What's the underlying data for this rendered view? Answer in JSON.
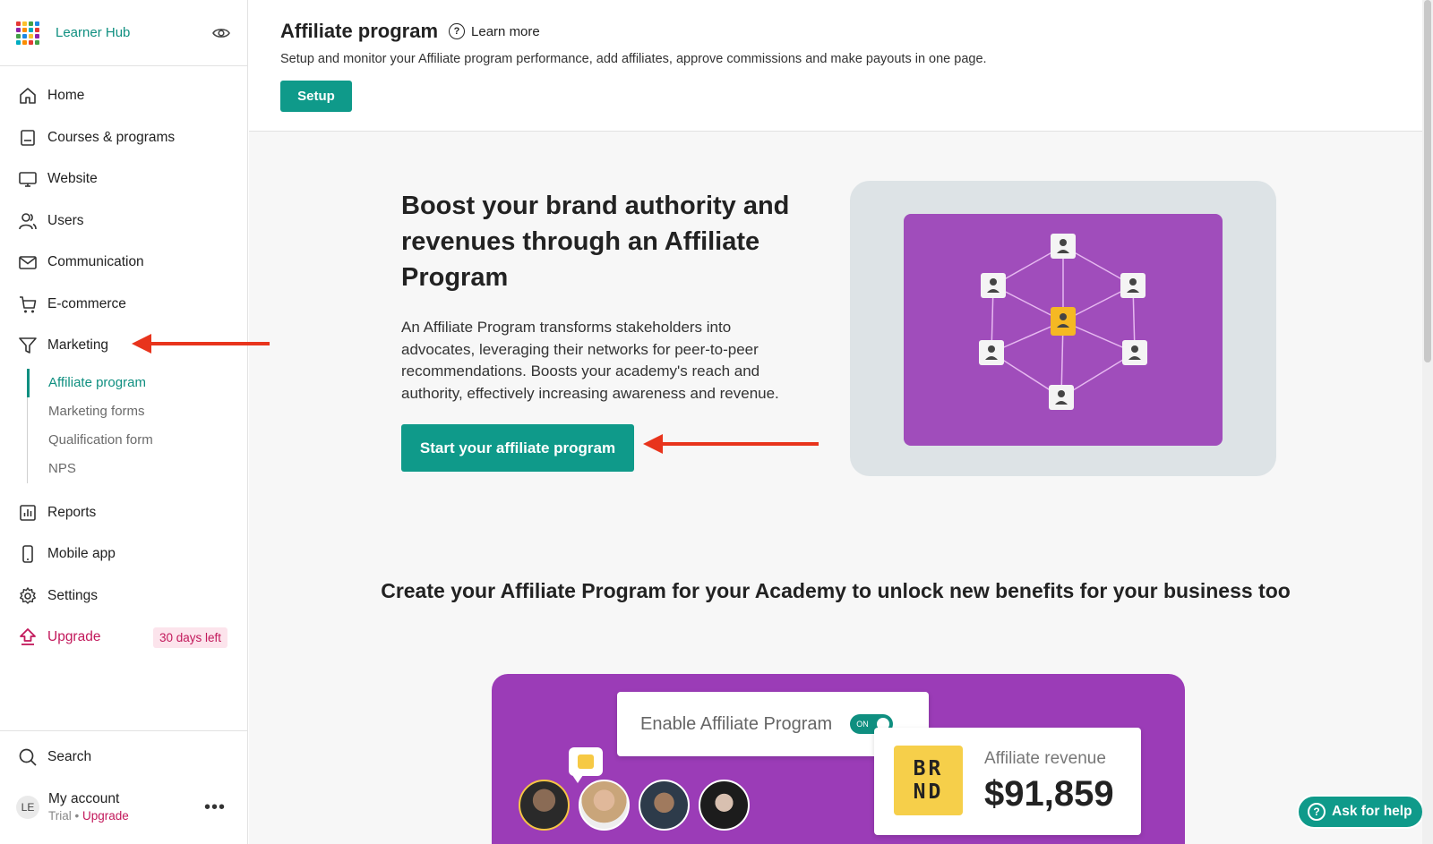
{
  "brand": {
    "name": "Learner Hub",
    "logo_colors": [
      "#e53935",
      "#fbc02d",
      "#43a047",
      "#1e88e5",
      "#8e24aa",
      "#fb8c00",
      "#00acc1",
      "#e53935",
      "#43a047",
      "#1e88e5",
      "#fbc02d",
      "#8e24aa",
      "#00acc1",
      "#fb8c00",
      "#e53935",
      "#43a047"
    ]
  },
  "sidebar": {
    "items": [
      {
        "label": "Home",
        "icon": "home-icon"
      },
      {
        "label": "Courses & programs",
        "icon": "book-icon"
      },
      {
        "label": "Website",
        "icon": "monitor-icon"
      },
      {
        "label": "Users",
        "icon": "users-icon"
      },
      {
        "label": "Communication",
        "icon": "mail-icon"
      },
      {
        "label": "E-commerce",
        "icon": "cart-icon"
      },
      {
        "label": "Marketing",
        "icon": "funnel-icon"
      }
    ],
    "marketing_sub": [
      {
        "label": "Affiliate program",
        "active": true
      },
      {
        "label": "Marketing forms",
        "active": false
      },
      {
        "label": "Qualification form",
        "active": false
      },
      {
        "label": "NPS",
        "active": false
      }
    ],
    "lower_items": [
      {
        "label": "Reports",
        "icon": "chart-icon"
      },
      {
        "label": "Mobile app",
        "icon": "phone-icon"
      },
      {
        "label": "Settings",
        "icon": "gear-icon"
      }
    ],
    "upgrade": {
      "label": "Upgrade",
      "badge": "30 days left",
      "icon": "upgrade-icon"
    },
    "search_label": "Search",
    "account": {
      "initials": "LE",
      "name": "My account",
      "plan": "Trial",
      "separator": " • ",
      "upgrade": "Upgrade",
      "more": "•••"
    }
  },
  "header": {
    "title": "Affiliate program",
    "learn_more": "Learn more",
    "description": "Setup and monitor your Affiliate program performance, add affiliates, approve commissions and make payouts in one page.",
    "setup_button": "Setup"
  },
  "hero": {
    "heading": "Boost your brand authority and revenues through an Affiliate Program",
    "body": "An Affiliate Program transforms stakeholders into advocates, leveraging their networks for peer-to-peer recommendations. Boosts your academy's reach and authority, effectively increasing awareness and revenue.",
    "cta": "Start your affiliate program"
  },
  "benefits_title": "Create your Affiliate Program for your Academy to unlock new benefits for your business too",
  "promo": {
    "enable_label": "Enable Affiliate Program",
    "toggle": "ON",
    "brand_mark": "BR\nND",
    "revenue_label": "Affiliate revenue",
    "revenue_value": "$91,859"
  },
  "help": {
    "label": "Ask for help"
  },
  "colors": {
    "accent": "#0f9a8a",
    "upgrade": "#c2185b",
    "annotation": "#e8341c",
    "promo_bg": "#9b3cb7"
  }
}
